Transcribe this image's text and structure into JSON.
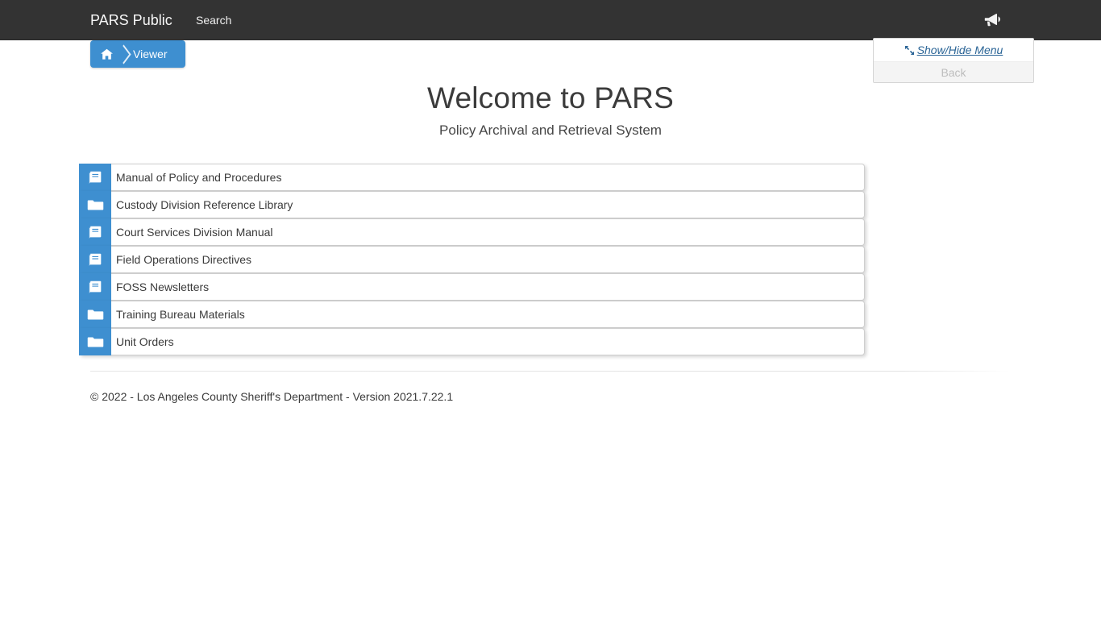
{
  "navbar": {
    "brand": "PARS Public",
    "search_label": "Search",
    "announce_icon": "megaphone-icon",
    "background": "#333333"
  },
  "breadcrumb": {
    "home_icon": "home-icon",
    "current": "Viewer",
    "accent": "#3e8fd0"
  },
  "menu_panel": {
    "toggle_label": "Show/Hide Menu",
    "toggle_icon": "expand-collapse-arrows-icon",
    "back_label": "Back",
    "link_color": "#2a6496",
    "back_color": "#bdbdbd"
  },
  "header": {
    "title": "Welcome to PARS",
    "subtitle": "Policy Archival and Retrieval System"
  },
  "list": {
    "items": [
      {
        "label": "Manual of Policy and Procedures",
        "icon": "book-icon"
      },
      {
        "label": "Custody Division Reference Library",
        "icon": "folder-icon"
      },
      {
        "label": "Court Services Division Manual",
        "icon": "book-icon"
      },
      {
        "label": "Field Operations Directives",
        "icon": "book-icon"
      },
      {
        "label": "FOSS Newsletters",
        "icon": "book-icon"
      },
      {
        "label": "Training Bureau Materials",
        "icon": "folder-icon"
      },
      {
        "label": "Unit Orders",
        "icon": "folder-icon"
      }
    ]
  },
  "footer": {
    "text": "© 2022 - Los Angeles County Sheriff's Department - Version 2021.7.22.1"
  }
}
